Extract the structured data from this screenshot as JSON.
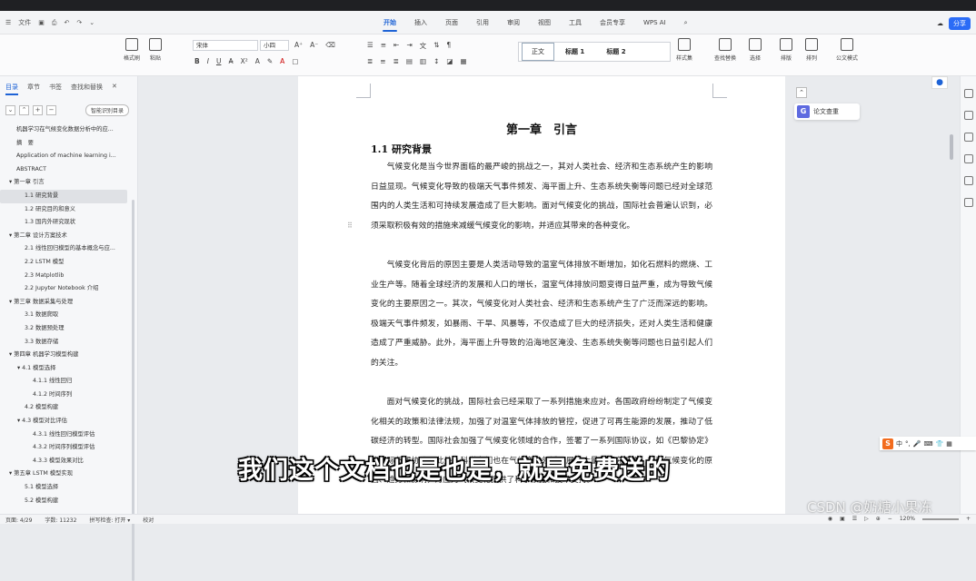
{
  "titlebar": {
    "menu_label": "文件",
    "tabs": [
      "开始",
      "插入",
      "页面",
      "引用",
      "审阅",
      "视图",
      "工具",
      "会员专享",
      "WPS AI"
    ],
    "active_tab": "开始",
    "share_label": "分享"
  },
  "ribbon": {
    "format_brush": "格式刷",
    "paste": "粘贴",
    "font_name": "宋体",
    "font_size": "小四",
    "styles": [
      "正文",
      "标题 1",
      "标题 2"
    ],
    "style_set": "样式集",
    "find_replace": "查找替换",
    "select": "选择",
    "sort": "排版",
    "layout": "排列",
    "formula_mode": "公文模式"
  },
  "sidebar": {
    "tabs": [
      "目录",
      "章节",
      "书签",
      "查找和替换"
    ],
    "active_tab": "目录",
    "ai_button": "智能识别目录",
    "toc": [
      {
        "label": "机器学习在气候变化数据分析中的应...",
        "indent": 0
      },
      {
        "label": "摘　要",
        "indent": 0
      },
      {
        "label": "Application of machine learning i...",
        "indent": 0
      },
      {
        "label": "ABSTRACT",
        "indent": 0
      },
      {
        "label": "▾ 第一章 引言",
        "indent": 0
      },
      {
        "label": "1.1 研究背景",
        "indent": 1,
        "selected": true
      },
      {
        "label": "1.2 研究目的和意义",
        "indent": 1
      },
      {
        "label": "1.3 国内外研究现状",
        "indent": 1
      },
      {
        "label": "▾ 第二章 设计方案技术",
        "indent": 0
      },
      {
        "label": "2.1 线性回归模型的基本概念与应...",
        "indent": 1
      },
      {
        "label": "2.2 LSTM 模型",
        "indent": 1
      },
      {
        "label": "2.3 Matplotlib",
        "indent": 1
      },
      {
        "label": "2.2 Jupyter Notebook 介绍",
        "indent": 1
      },
      {
        "label": "▾ 第三章 数据采集与处理",
        "indent": 0
      },
      {
        "label": "3.1 数据爬取",
        "indent": 1
      },
      {
        "label": "3.2 数据预处理",
        "indent": 1
      },
      {
        "label": "3.3 数据存储",
        "indent": 1
      },
      {
        "label": "▾ 第四章 机器学习模型构建",
        "indent": 0
      },
      {
        "label": "▾ 4.1 模型选择",
        "indent": 1
      },
      {
        "label": "4.1.1 线性回归",
        "indent": 2
      },
      {
        "label": "4.1.2 时间序列",
        "indent": 2
      },
      {
        "label": "4.2 模型构建",
        "indent": 1
      },
      {
        "label": "▾ 4.3 模型对比评估",
        "indent": 1
      },
      {
        "label": "4.3.1 线性回归模型评估",
        "indent": 2
      },
      {
        "label": "4.3.2 时间序列模型评估",
        "indent": 2
      },
      {
        "label": "4.3.3 模型效果对比",
        "indent": 2
      },
      {
        "label": "▾ 第五章 LSTM 模型实现",
        "indent": 0
      },
      {
        "label": "5.1 模型选择",
        "indent": 1
      },
      {
        "label": "5.2 模型构建",
        "indent": 1
      }
    ]
  },
  "document": {
    "chapter_title": "第一章　引言",
    "section_title": "1.1  研究背景",
    "paragraphs": [
      "气候变化是当今世界面临的最严峻的挑战之一，其对人类社会、经济和生态系统产生的影响日益显现。气候变化导致的极端天气事件频发、海平面上升、生态系统失衡等问题已经对全球范围内的人类生活和可持续发展造成了巨大影响。面对气候变化的挑战，国际社会普遍认识到，必须采取积极有效的措施来减缓气候变化的影响，并适应其带来的各种变化。",
      "气候变化背后的原因主要是人类活动导致的温室气体排放不断增加，如化石燃料的燃烧、工业生产等。随着全球经济的发展和人口的增长，温室气体排放问题变得日益严重，成为导致气候变化的主要原因之一。其次，气候变化对人类社会、经济和生态系统产生了广泛而深远的影响。极端天气事件频发，如暴雨、干旱、风暴等，不仅造成了巨大的经济损失，还对人类生活和健康造成了严重威胁。此外，海平面上升导致的沿海地区淹没、生态系统失衡等问题也日益引起人们的关注。",
      "面对气候变化的挑战，国际社会已经采取了一系列措施来应对。各国政府纷纷制定了气候变化相关的政策和法律法规，加强了对温室气体排放的管控，促进了可再生能源的发展，推动了低碳经济的转型。国际社会加强了气候变化领域的合作，签署了一系列国际协议，如《巴黎协定》等国际气候协议。此外，科学家们也在气候变化领域开展了大量的研究工作，探索气候变化的原因、趋势和影响，为应对气候变化提供了科学依据和技术支持。"
    ]
  },
  "float_panel": {
    "label": "论文查重",
    "icon": "G"
  },
  "subtitle": "我们这个文档也是也是，就是免费送的",
  "watermark": "CSDN @奶糖小果冻",
  "ime": {
    "icon": "S",
    "label": "中"
  },
  "statusbar": {
    "page": "页面: 4/29",
    "words": "字数: 11232",
    "spellcheck": "拼写检查: 打开 ▾",
    "proofread": "校对",
    "zoom": "120%"
  }
}
